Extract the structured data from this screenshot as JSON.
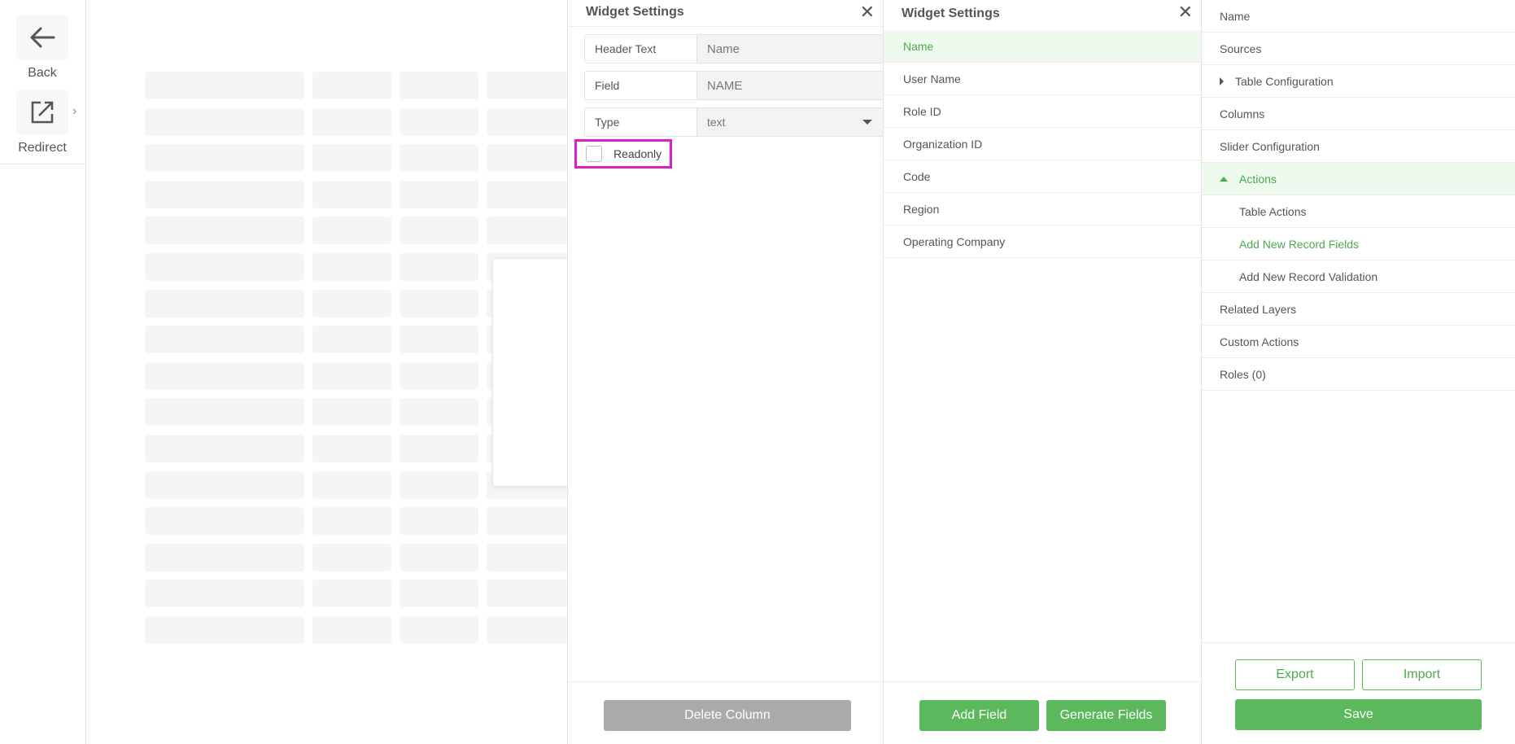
{
  "toolbar": {
    "back_label": "Back",
    "redirect_label": "Redirect"
  },
  "column_panel": {
    "title": "Widget Settings",
    "fields": [
      {
        "label": "Header Text",
        "value": "Name"
      },
      {
        "label": "Field",
        "value": "NAME"
      },
      {
        "label": "Type",
        "value": "text"
      }
    ],
    "readonly_label": "Readonly",
    "readonly_checked": false,
    "delete_label": "Delete Column"
  },
  "fields_panel": {
    "title": "Widget Settings",
    "items": [
      "Name",
      "User Name",
      "Role ID",
      "Organization ID",
      "Code",
      "Region",
      "Operating Company"
    ],
    "active_index": 0,
    "add_label": "Add Field",
    "generate_label": "Generate Fields"
  },
  "nav_panel": {
    "items": [
      {
        "label": "Name"
      },
      {
        "label": "Sources"
      },
      {
        "label": "Table Configuration"
      },
      {
        "label": "Columns"
      },
      {
        "label": "Slider Configuration"
      },
      {
        "label": "Actions"
      },
      {
        "label": "Table Actions"
      },
      {
        "label": "Add New Record Fields"
      },
      {
        "label": "Add New Record Validation"
      },
      {
        "label": "Related Layers"
      },
      {
        "label": "Custom Actions"
      },
      {
        "label": "Roles (0)"
      }
    ],
    "export_label": "Export",
    "import_label": "Import",
    "save_label": "Save"
  },
  "colors": {
    "accent": "#5cb85c",
    "highlight": "#e01ec8",
    "active_bg": "#eefaee"
  }
}
